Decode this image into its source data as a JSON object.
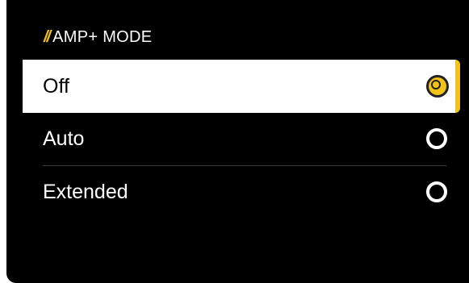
{
  "header": {
    "slashes": "//",
    "title": "AMP+ MODE"
  },
  "options": [
    {
      "label": "Off",
      "selected": true
    },
    {
      "label": "Auto",
      "selected": false
    },
    {
      "label": "Extended",
      "selected": false
    }
  ],
  "colors": {
    "accent": "#f2c218",
    "background": "#000000",
    "text": "#ffffff",
    "selected_bg": "#ffffff"
  }
}
